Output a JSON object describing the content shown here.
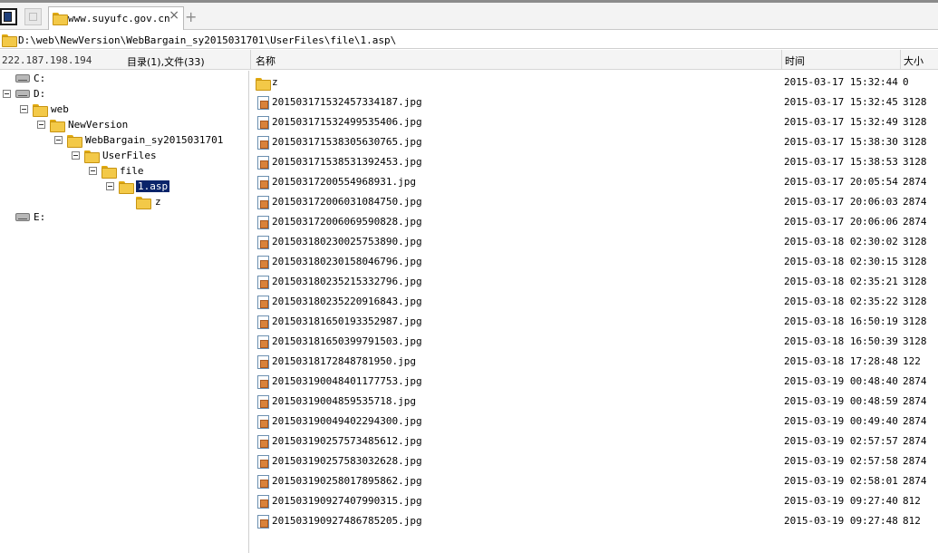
{
  "tabs": [
    {
      "label": "www.suyufc.gov.cn"
    }
  ],
  "path": "D:\\web\\NewVersion\\WebBargain_sy2015031701\\UserFiles\\file\\1.asp\\",
  "host_ip": "222.187.198.194",
  "counts": "目录(1),文件(33)",
  "columns": {
    "name": "名称",
    "time": "时间",
    "size": "大小"
  },
  "tree": {
    "c": "C:",
    "d": "D:",
    "web": "web",
    "newversion": "NewVersion",
    "webbargain": "WebBargain_sy2015031701",
    "userfiles": "UserFiles",
    "file": "file",
    "asp": "1.asp",
    "z": "z",
    "e": "E:"
  },
  "files": [
    {
      "name": "z",
      "time": "2015-03-17 15:32:44",
      "size": "0",
      "type": "folder"
    },
    {
      "name": "20150317153245733 4187.jpg",
      "time": "2015-03-17 15:32:45",
      "size": "3128",
      "type": "jpg"
    },
    {
      "name": "20150317153249953 5406.jpg",
      "time": "2015-03-17 15:32:49",
      "size": "3128",
      "type": "jpg"
    },
    {
      "name": "20150317153830563 0765.jpg",
      "time": "2015-03-17 15:38:30",
      "size": "3128",
      "type": "jpg"
    },
    {
      "name": "20150317153853139 2453.jpg",
      "time": "2015-03-17 15:38:53",
      "size": "3128",
      "type": "jpg"
    },
    {
      "name": "20150317200554968931.jpg",
      "time": "2015-03-17 20:05:54",
      "size": "2874",
      "type": "jpg"
    },
    {
      "name": "2015031720060310847 50.jpg",
      "time": "2015-03-17 20:06:03",
      "size": "2874",
      "type": "jpg"
    },
    {
      "name": "2015031720060695908 28.jpg",
      "time": "2015-03-17 20:06:06",
      "size": "2874",
      "type": "jpg"
    },
    {
      "name": "2015031802300257538 90.jpg",
      "time": "2015-03-18 02:30:02",
      "size": "3128",
      "type": "jpg"
    },
    {
      "name": "2015031802301580467 96.jpg",
      "time": "2015-03-18 02:30:15",
      "size": "3128",
      "type": "jpg"
    },
    {
      "name": "2015031802352153327 96.jpg",
      "time": "2015-03-18 02:35:21",
      "size": "3128",
      "type": "jpg"
    },
    {
      "name": "2015031802352209168 43.jpg",
      "time": "2015-03-18 02:35:22",
      "size": "3128",
      "type": "jpg"
    },
    {
      "name": "2015031816501933529 87.jpg",
      "time": "2015-03-18 16:50:19",
      "size": "3128",
      "type": "jpg"
    },
    {
      "name": "2015031816503997915 03.jpg",
      "time": "2015-03-18 16:50:39",
      "size": "3128",
      "type": "jpg"
    },
    {
      "name": "20150318172848781950.jpg",
      "time": "2015-03-18 17:28:48",
      "size": "122",
      "type": "jpg"
    },
    {
      "name": "2015031900484011777 53.jpg",
      "time": "2015-03-19 00:48:40",
      "size": "2874",
      "type": "jpg"
    },
    {
      "name": "20150319004859535718.jpg",
      "time": "2015-03-19 00:48:59",
      "size": "2874",
      "type": "jpg"
    },
    {
      "name": "2015031900494022943 00.jpg",
      "time": "2015-03-19 00:49:40",
      "size": "2874",
      "type": "jpg"
    },
    {
      "name": "2015031902575734856 12.jpg",
      "time": "2015-03-19 02:57:57",
      "size": "2874",
      "type": "jpg"
    },
    {
      "name": "2015031902575830326 28.jpg",
      "time": "2015-03-19 02:57:58",
      "size": "2874",
      "type": "jpg"
    },
    {
      "name": "2015031902580178958 62.jpg",
      "time": "2015-03-19 02:58:01",
      "size": "2874",
      "type": "jpg"
    },
    {
      "name": "2015031909274079903 15.jpg",
      "time": "2015-03-19 09:27:40",
      "size": "812",
      "type": "jpg"
    },
    {
      "name": "2015031909274867852 05.jpg",
      "time": "2015-03-19 09:27:48",
      "size": "812",
      "type": "jpg"
    }
  ]
}
